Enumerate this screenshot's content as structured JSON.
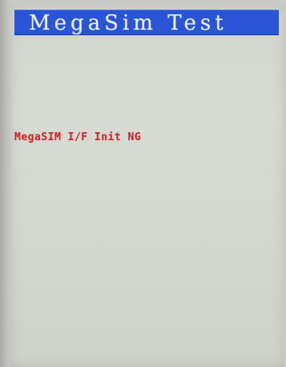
{
  "window": {
    "title": "MegaSim Test"
  },
  "main": {
    "status_message": "MegaSIM I/F Init NG"
  },
  "colors": {
    "title_bar": "#2a54d6",
    "title_text": "#eef2ff",
    "status_text": "#cc2a2a",
    "screen_background": "#d6d8d2"
  }
}
